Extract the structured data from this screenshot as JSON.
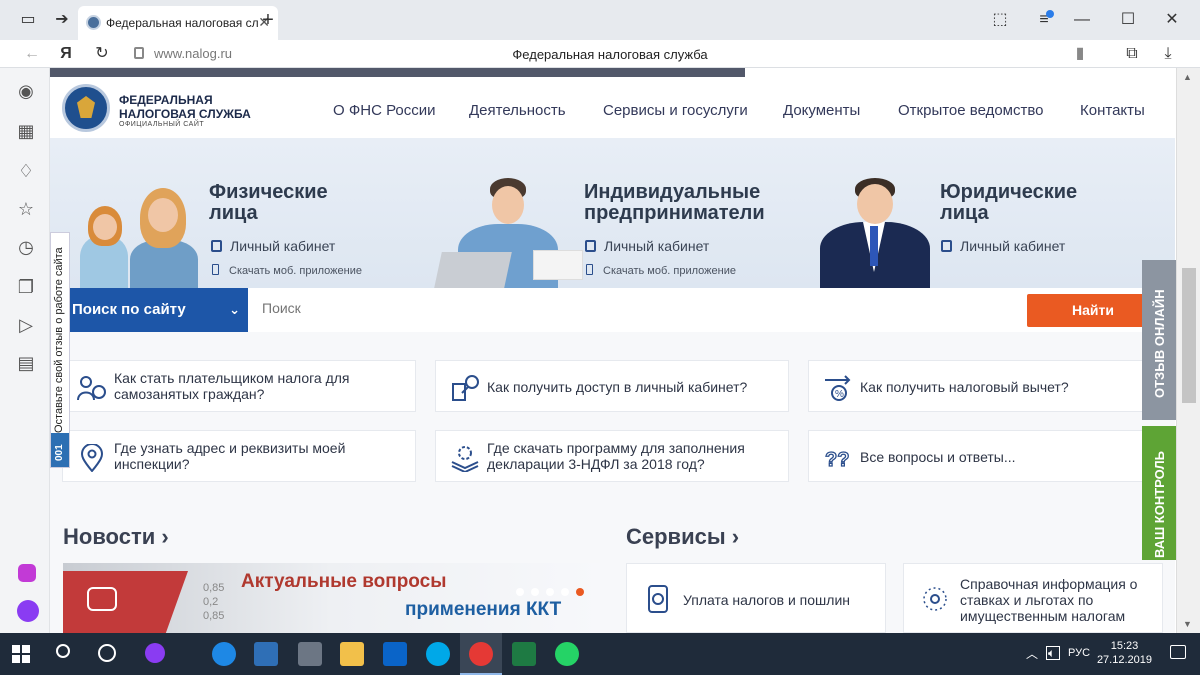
{
  "browser": {
    "tab_title": "Федеральная налоговая сл",
    "url_domain": "www.nalog.ru",
    "page_title": "Федеральная налоговая служба",
    "yandex_letter": "Я"
  },
  "site": {
    "brand_line1": "ФЕДЕРАЛЬНАЯ",
    "brand_line2": "НАЛОГОВАЯ СЛУЖБА",
    "brand_line3": "ОФИЦИАЛЬНЫЙ САЙТ",
    "nav": [
      "О ФНС России",
      "Деятельность",
      "Сервисы и госуслуги",
      "Документы",
      "Открытое ведомство",
      "Контакты"
    ]
  },
  "hero": {
    "categories": [
      {
        "title1": "Физические",
        "title2": "лица",
        "cabinet": "Личный кабинет",
        "app": "Скачать моб. приложение"
      },
      {
        "title1": "Индивидуальные",
        "title2": "предприниматели",
        "cabinet": "Личный кабинет",
        "app": "Скачать моб. приложение"
      },
      {
        "title1": "Юридические",
        "title2": "лица",
        "cabinet": "Личный кабинет",
        "app": ""
      }
    ]
  },
  "search": {
    "scope": "Поиск по сайту",
    "placeholder": "Поиск",
    "button": "Найти"
  },
  "quick_links": [
    {
      "line1": "Как стать плательщиком налога для",
      "line2": "самозанятых граждан?"
    },
    {
      "line1": "Как получить доступ в личный кабинет?",
      "line2": ""
    },
    {
      "line1": "Как получить налоговый вычет?",
      "line2": ""
    },
    {
      "line1": "Где узнать адрес и реквизиты моей",
      "line2": "инспекции?"
    },
    {
      "line1": "Где скачать программу для заполнения",
      "line2": "декларации 3-НДФЛ за 2018 год?"
    },
    {
      "line1": "Все вопросы и ответы...",
      "line2": ""
    }
  ],
  "sections": {
    "news_title": "Новости",
    "services_title": "Сервисы",
    "news_banner_line1": "Актуальные вопросы",
    "news_banner_line2": "применения ККТ",
    "news_banner_nums": "0,85\n0,2\n0,85",
    "service1": "Уплата налогов и пошлин",
    "service2_l1": "Справочная информация о",
    "service2_l2": "ставках и льготах по",
    "service2_l3": "имущественным налогам"
  },
  "side_tabs": {
    "feedback": "Оставьте свой отзыв о работе сайта",
    "feedback_num": "001",
    "online_review": "ОТЗЫВ ОНЛАЙН",
    "your_control": "ВАШ КОНТРОЛЬ"
  },
  "taskbar": {
    "lang": "РУС",
    "time": "15:23",
    "date": "27.12.2019"
  },
  "colors": {
    "accent_blue": "#1d56a8",
    "search_button": "#ea5a22",
    "green_tab": "#5ea435",
    "gray_tab": "#8c95a1"
  }
}
